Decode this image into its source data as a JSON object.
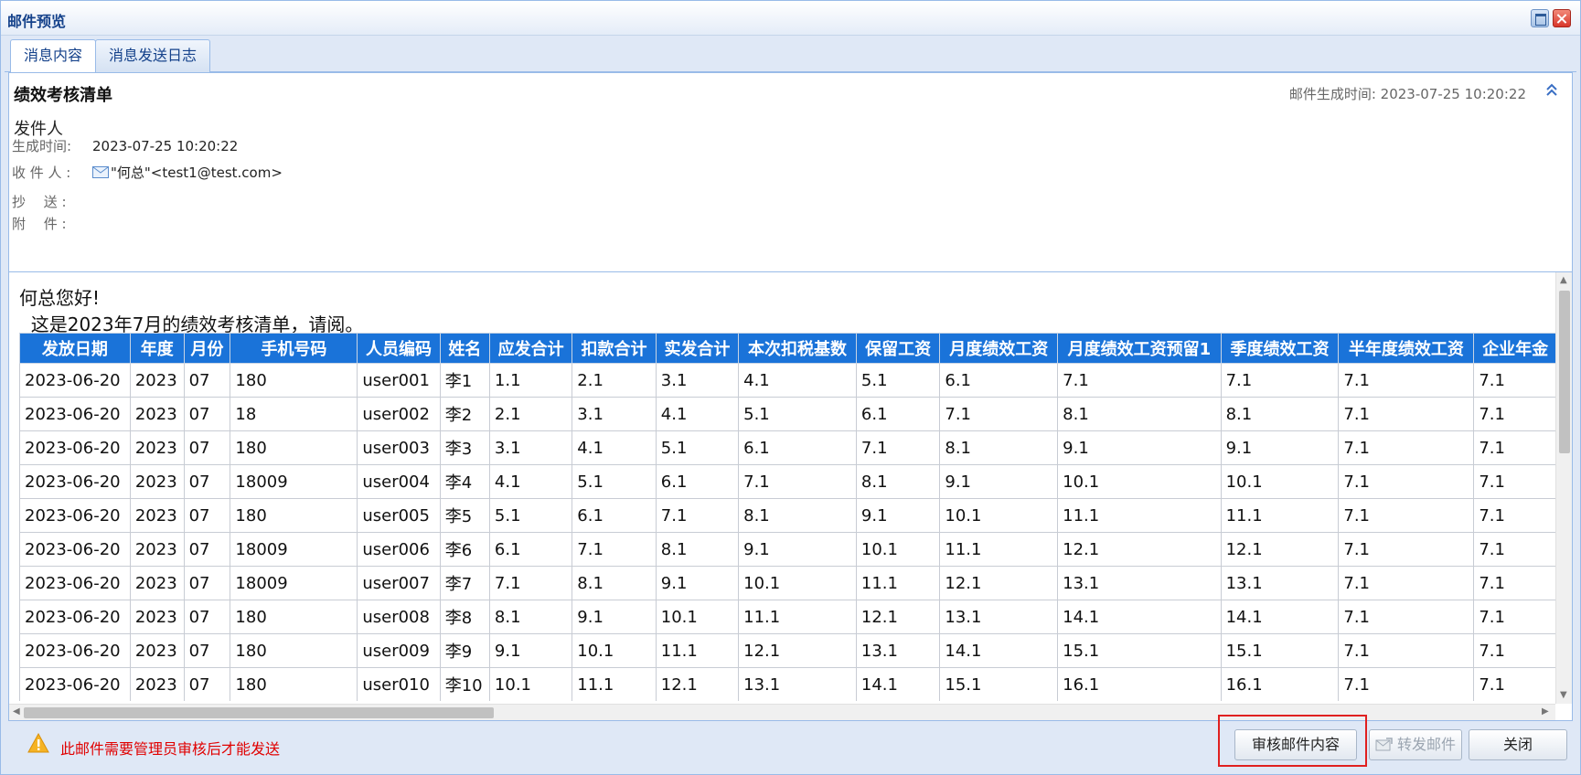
{
  "window": {
    "title": "邮件预览"
  },
  "tabs": [
    {
      "label": "消息内容",
      "active": true
    },
    {
      "label": "消息发送日志",
      "active": false
    }
  ],
  "mail": {
    "subject": "绩效考核清单",
    "generated_time_right": "邮件生成时间: 2023-07-25 10:20:22",
    "sender_label": "发件人",
    "fields": {
      "time_label": "生成时间:",
      "time_value": "2023-07-25 10:20:22",
      "to_label": "收 件 人 :",
      "to_value": "\"何总\"<test1@test.com>",
      "cc_label": "抄　 送 :",
      "attach_label": "附　 件 :"
    }
  },
  "body": {
    "greeting": "何总您好!",
    "intro": "  这是2023年7月的绩效考核清单，请阅。"
  },
  "table": {
    "headers": [
      "发放日期",
      "年度",
      "月份",
      "手机号码",
      "人员编码",
      "姓名",
      "应发合计",
      "扣款合计",
      "实发合计",
      "本次扣税基数",
      "保留工资",
      "月度绩效工资",
      "月度绩效工资预留1",
      "季度绩效工资",
      "半年度绩效工资",
      "企业年金（个人"
    ],
    "rows": [
      [
        "2023-06-20",
        "2023",
        "07",
        "180",
        "user001",
        "李1",
        "1.1",
        "2.1",
        "3.1",
        "4.1",
        "5.1",
        "6.1",
        "7.1",
        "7.1",
        "7.1",
        "7.1"
      ],
      [
        "2023-06-20",
        "2023",
        "07",
        "18",
        "user002",
        "李2",
        "2.1",
        "3.1",
        "4.1",
        "5.1",
        "6.1",
        "7.1",
        "8.1",
        "8.1",
        "7.1",
        "7.1"
      ],
      [
        "2023-06-20",
        "2023",
        "07",
        "180",
        "user003",
        "李3",
        "3.1",
        "4.1",
        "5.1",
        "6.1",
        "7.1",
        "8.1",
        "9.1",
        "9.1",
        "7.1",
        "7.1"
      ],
      [
        "2023-06-20",
        "2023",
        "07",
        "18009",
        "user004",
        "李4",
        "4.1",
        "5.1",
        "6.1",
        "7.1",
        "8.1",
        "9.1",
        "10.1",
        "10.1",
        "7.1",
        "7.1"
      ],
      [
        "2023-06-20",
        "2023",
        "07",
        "180",
        "user005",
        "李5",
        "5.1",
        "6.1",
        "7.1",
        "8.1",
        "9.1",
        "10.1",
        "11.1",
        "11.1",
        "7.1",
        "7.1"
      ],
      [
        "2023-06-20",
        "2023",
        "07",
        "18009",
        "user006",
        "李6",
        "6.1",
        "7.1",
        "8.1",
        "9.1",
        "10.1",
        "11.1",
        "12.1",
        "12.1",
        "7.1",
        "7.1"
      ],
      [
        "2023-06-20",
        "2023",
        "07",
        "18009",
        "user007",
        "李7",
        "7.1",
        "8.1",
        "9.1",
        "10.1",
        "11.1",
        "12.1",
        "13.1",
        "13.1",
        "7.1",
        "7.1"
      ],
      [
        "2023-06-20",
        "2023",
        "07",
        "180",
        "user008",
        "李8",
        "8.1",
        "9.1",
        "10.1",
        "11.1",
        "12.1",
        "13.1",
        "14.1",
        "14.1",
        "7.1",
        "7.1"
      ],
      [
        "2023-06-20",
        "2023",
        "07",
        "180",
        "user009",
        "李9",
        "9.1",
        "10.1",
        "11.1",
        "12.1",
        "13.1",
        "14.1",
        "15.1",
        "15.1",
        "7.1",
        "7.1"
      ],
      [
        "2023-06-20",
        "2023",
        "07",
        "180",
        "user010",
        "李10",
        "10.1",
        "11.1",
        "12.1",
        "13.1",
        "14.1",
        "15.1",
        "16.1",
        "16.1",
        "7.1",
        "7.1"
      ]
    ]
  },
  "footer": {
    "warning": "此邮件需要管理员审核后才能发送",
    "review_button": "审核邮件内容",
    "forward_button": "转发邮件",
    "close_button": "关闭"
  },
  "colors": {
    "header_bg": "#1a73d9",
    "warning_text": "#e00000",
    "highlight": "#e02020"
  },
  "icons": {
    "collapse": "double-chevron-up-icon",
    "envelope": "envelope-icon",
    "warning": "warning-triangle-icon",
    "forward": "forward-mail-icon"
  }
}
